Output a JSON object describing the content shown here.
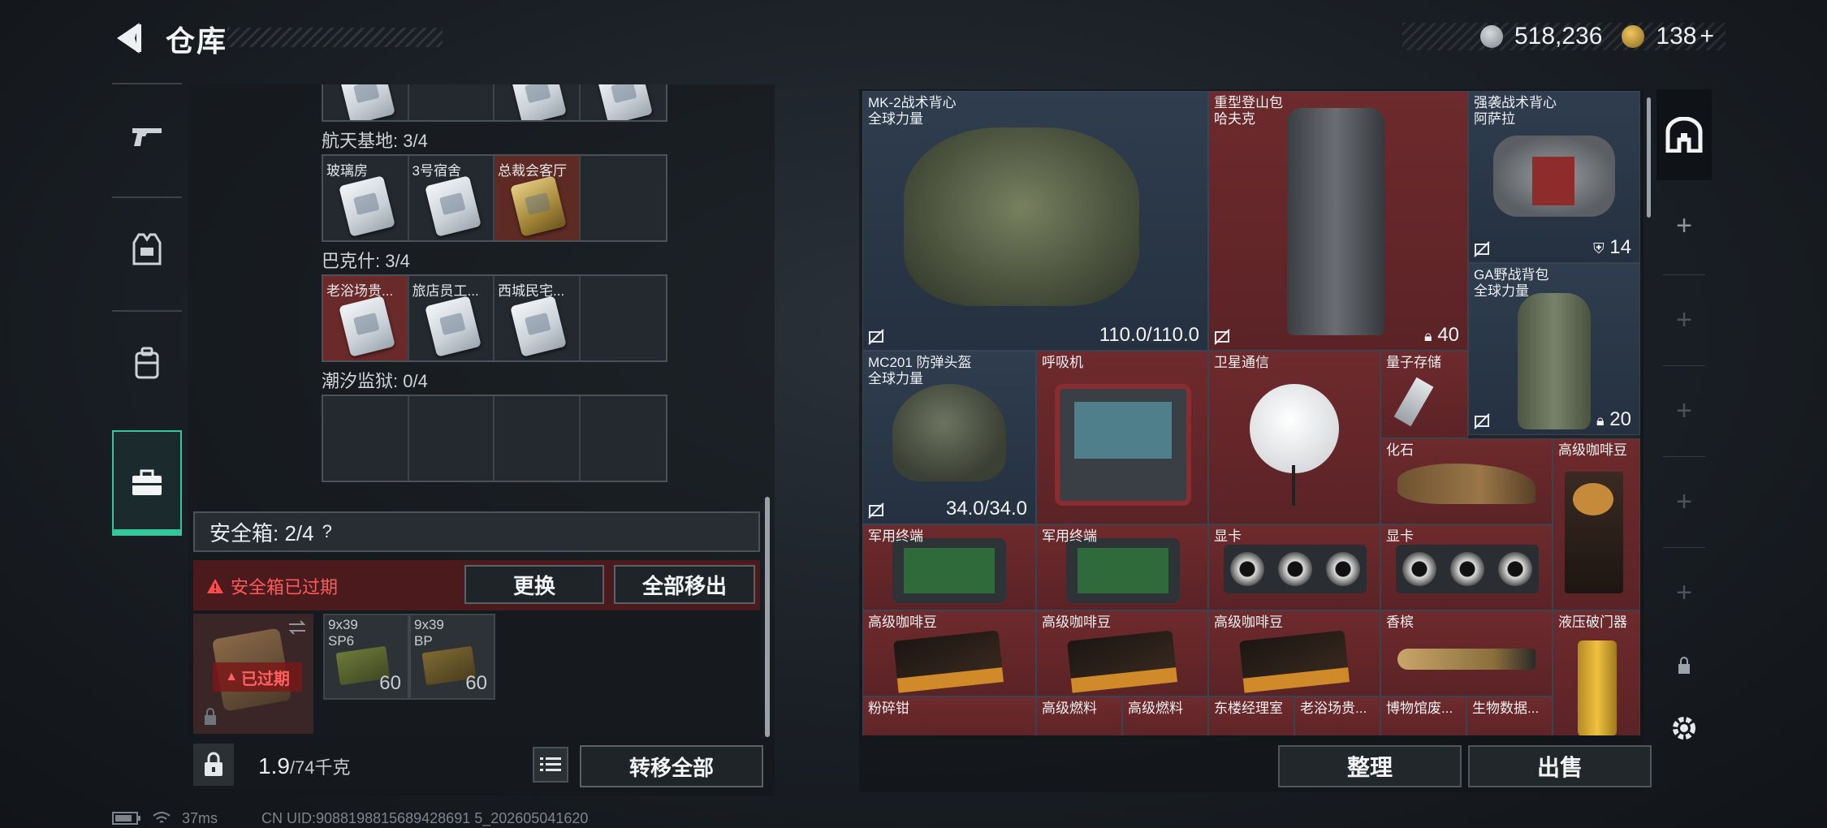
{
  "header": {
    "title": "仓库",
    "currency": {
      "hafcoin": "518,236",
      "tokens": "138",
      "tokens_add": "+"
    }
  },
  "left_rail": [
    {
      "name": "weapons",
      "icon": "gun-icon"
    },
    {
      "name": "equipment",
      "icon": "vest-icon"
    },
    {
      "name": "backpack",
      "icon": "backpack-icon"
    },
    {
      "name": "keycards",
      "icon": "briefcase-icon",
      "active": true
    }
  ],
  "keycard_groups": [
    {
      "label": "航天基地: 3/4",
      "cells": [
        {
          "name": "玻璃房",
          "type": "silver"
        },
        {
          "name": "3号宿舍",
          "type": "silver"
        },
        {
          "name": "总裁会客厅",
          "type": "gold"
        },
        {
          "name": "",
          "type": "empty"
        }
      ]
    },
    {
      "label": "巴克什: 3/4",
      "cells": [
        {
          "name": "老浴场贵...",
          "type": "silver"
        },
        {
          "name": "旅店员工...",
          "type": "silver"
        },
        {
          "name": "西城民宅...",
          "type": "silver"
        },
        {
          "name": "",
          "type": "empty"
        }
      ]
    },
    {
      "label": "潮汐监狱: 0/4",
      "cells": [
        {
          "name": "",
          "type": "empty"
        },
        {
          "name": "",
          "type": "empty"
        },
        {
          "name": "",
          "type": "empty"
        },
        {
          "name": "",
          "type": "empty"
        }
      ]
    }
  ],
  "safebox": {
    "header": "安全箱: 2/4",
    "help": "?",
    "expired_notice": "安全箱已过期",
    "replace_label": "更换",
    "move_all_label": "全部移出",
    "item_badge": "已过期",
    "ammo": [
      {
        "name": "9x39\nSP6",
        "qty": "60"
      },
      {
        "name": "9x39\nBP",
        "qty": "60"
      }
    ]
  },
  "left_footer": {
    "weight": "1.9",
    "weight_max": "/74千克",
    "transfer_all_label": "转移全部"
  },
  "stash_items": [
    {
      "name": "MK-2战术背心\n全球力量",
      "value": "110.0/110.0",
      "color": "blue",
      "no_insure": true
    },
    {
      "name": "重型登山包\n哈夫克",
      "value": "40",
      "color": "red",
      "no_insure": true,
      "value_icon": "lock"
    },
    {
      "name": "强袭战术背心\n阿萨拉",
      "value": "14",
      "color": "blue",
      "no_insure": true,
      "value_icon": "armor"
    },
    {
      "name": "GA野战背包\n全球力量",
      "value": "20",
      "color": "blue",
      "no_insure": true,
      "value_icon": "lock"
    },
    {
      "name": "MC201 防弹头盔\n全球力量",
      "value": "34.0/34.0",
      "color": "blue",
      "no_insure": true
    },
    {
      "name": "呼吸机",
      "value": "",
      "color": "red"
    },
    {
      "name": "卫星通信",
      "value": "",
      "color": "red"
    },
    {
      "name": "量子存储",
      "value": "",
      "color": "red"
    },
    {
      "name": "化石",
      "value": "",
      "color": "red"
    },
    {
      "name": "高级咖啡豆",
      "value": "",
      "color": "red"
    },
    {
      "name": "军用终端",
      "value": "",
      "color": "red"
    },
    {
      "name": "军用终端",
      "value": "",
      "color": "red"
    },
    {
      "name": "显卡",
      "value": "",
      "color": "red"
    },
    {
      "name": "显卡",
      "value": "",
      "color": "red"
    },
    {
      "name": "高级咖啡豆",
      "value": "",
      "color": "red"
    },
    {
      "name": "高级咖啡豆",
      "value": "",
      "color": "red"
    },
    {
      "name": "高级咖啡豆",
      "value": "",
      "color": "red"
    },
    {
      "name": "香槟",
      "value": "",
      "color": "red"
    },
    {
      "name": "液压破门器",
      "value": "",
      "color": "red"
    },
    {
      "name": "粉碎钳",
      "value": "",
      "color": "red"
    },
    {
      "name": "高级燃料",
      "value": "",
      "color": "red"
    },
    {
      "name": "高级燃料",
      "value": "",
      "color": "red"
    },
    {
      "name": "东楼经理室",
      "value": "",
      "color": "red"
    },
    {
      "name": "老浴场贵...",
      "value": "",
      "color": "red"
    },
    {
      "name": "博物馆废...",
      "value": "",
      "color": "red"
    },
    {
      "name": "生物数据...",
      "value": "",
      "color": "red"
    }
  ],
  "right_actions": {
    "tidy_label": "整理",
    "sell_label": "出售"
  },
  "right_rail": {
    "add": "+"
  },
  "status_bar": {
    "ping": "37ms",
    "uid": "CN UID:9088198815689428691 5_202605041620"
  }
}
